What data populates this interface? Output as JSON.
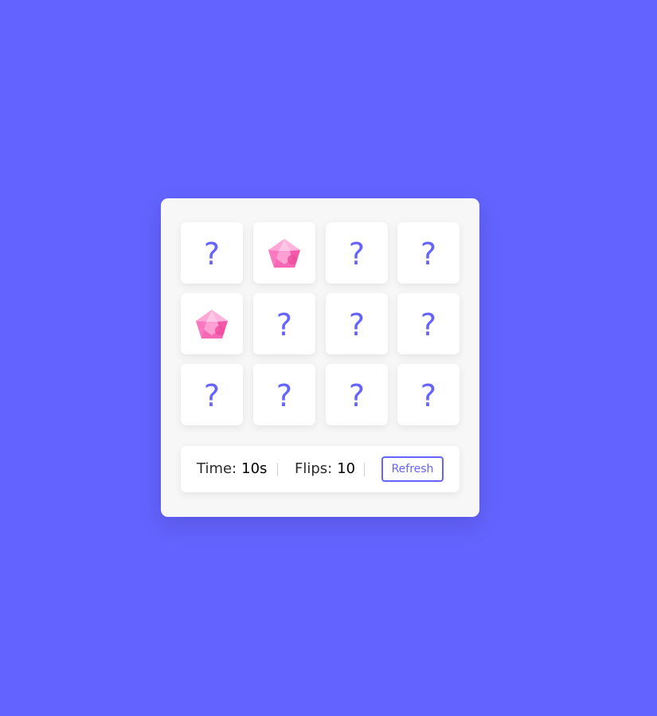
{
  "colors": {
    "background": "#6363ff",
    "accent": "#6563ff",
    "card": "#ffffff",
    "panel": "#f7f7f7",
    "gem_pink": "#f06fc0"
  },
  "cards": [
    {
      "state": "hidden",
      "label": "?",
      "icon": "question-mark"
    },
    {
      "state": "flipped",
      "label": "",
      "icon": "pink-gem-icon"
    },
    {
      "state": "hidden",
      "label": "?",
      "icon": "question-mark"
    },
    {
      "state": "hidden",
      "label": "?",
      "icon": "question-mark"
    },
    {
      "state": "flipped",
      "label": "",
      "icon": "pink-gem-icon"
    },
    {
      "state": "hidden",
      "label": "?",
      "icon": "question-mark"
    },
    {
      "state": "hidden",
      "label": "?",
      "icon": "question-mark"
    },
    {
      "state": "hidden",
      "label": "?",
      "icon": "question-mark"
    },
    {
      "state": "hidden",
      "label": "?",
      "icon": "question-mark"
    },
    {
      "state": "hidden",
      "label": "?",
      "icon": "question-mark"
    },
    {
      "state": "hidden",
      "label": "?",
      "icon": "question-mark"
    },
    {
      "state": "hidden",
      "label": "?",
      "icon": "question-mark"
    }
  ],
  "details": {
    "time_label": "Time:",
    "time_value": "10s",
    "flips_label": "Flips:",
    "flips_value": "10",
    "refresh_label": "Refresh"
  }
}
